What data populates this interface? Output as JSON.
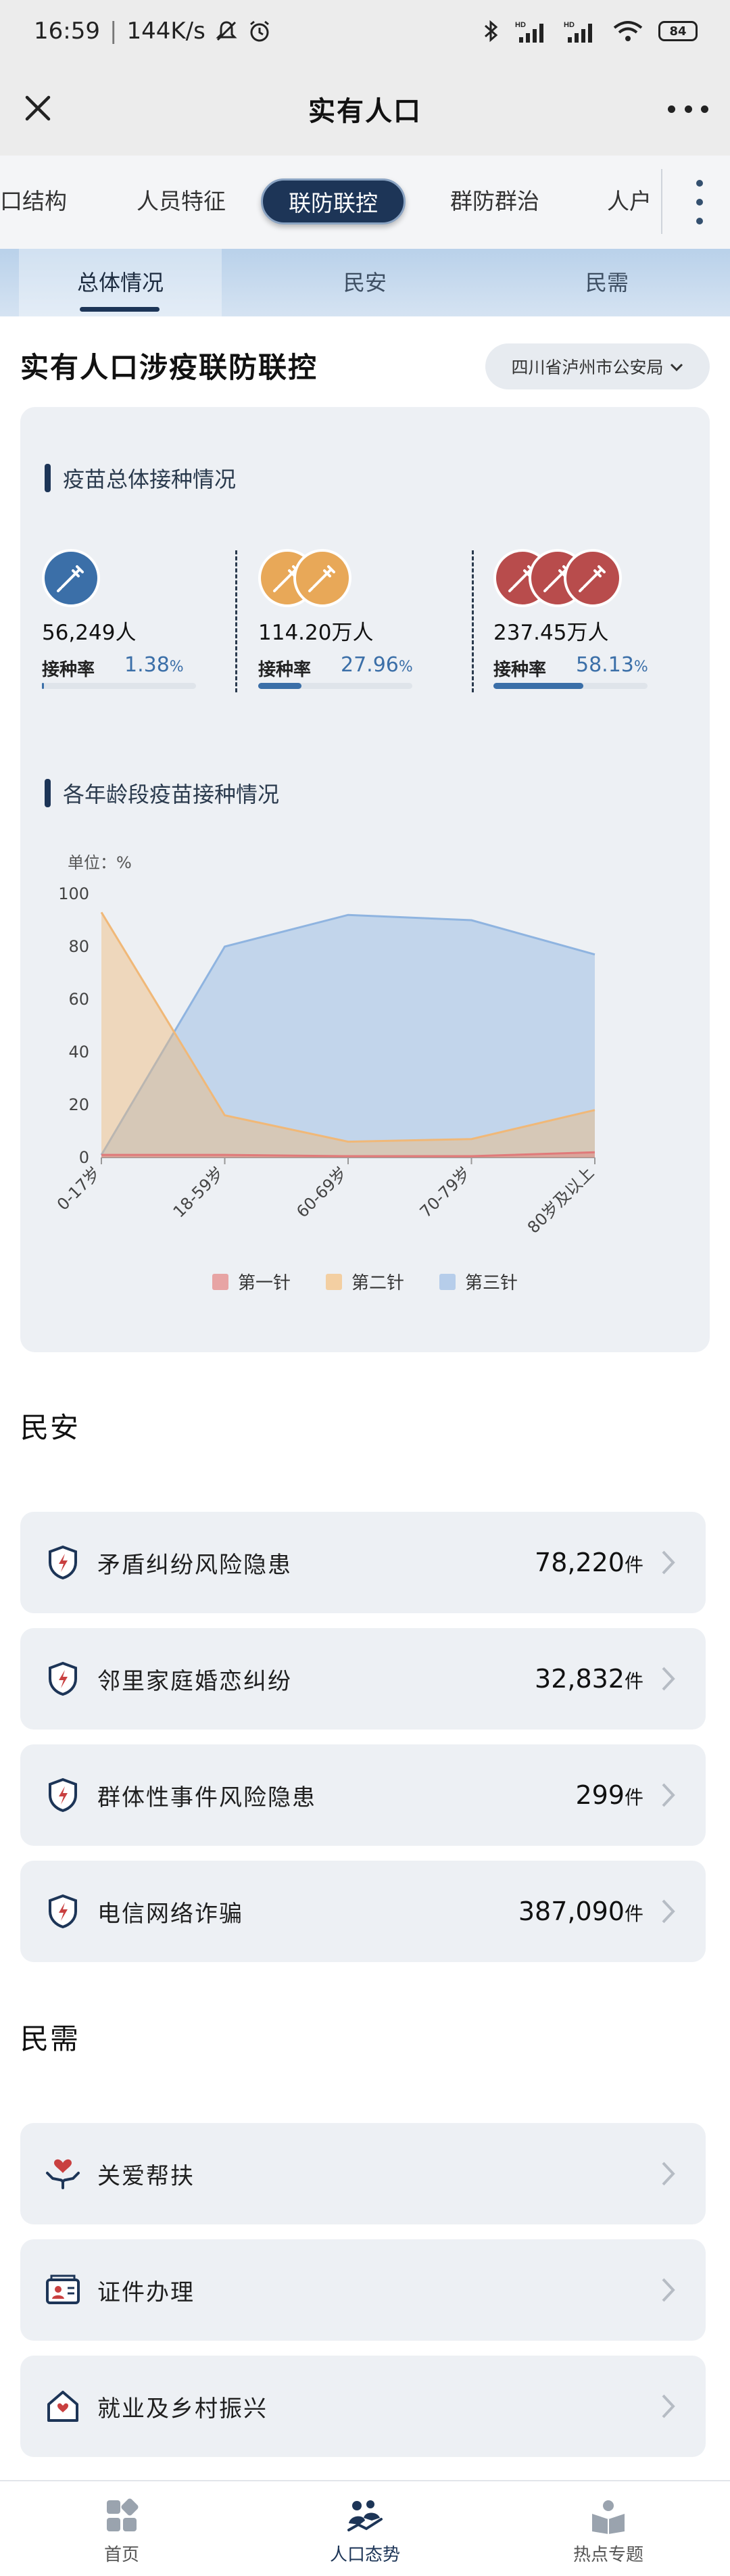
{
  "status_bar": {
    "time": "16:59",
    "speed": "144K/s",
    "battery": "84"
  },
  "header": {
    "title": "实有人口"
  },
  "category_tabs": [
    {
      "label": "口结构"
    },
    {
      "label": "人员特征"
    },
    {
      "label": "联防联控"
    },
    {
      "label": "群防群治"
    },
    {
      "label": "人户"
    }
  ],
  "sub_tabs": [
    {
      "label": "总体情况"
    },
    {
      "label": "民安"
    },
    {
      "label": "民需"
    }
  ],
  "section": {
    "title": "实有人口涉疫联防联控",
    "region": "四川省泸州市公安局"
  },
  "vaccination": {
    "title": "疫苗总体接种情况",
    "rate_label": "接种率",
    "items": [
      {
        "count": "56,249人",
        "rate": "1.38",
        "unit": "%",
        "color": "#3b6fa8",
        "fraction": 0.0138
      },
      {
        "count": "114.20万人",
        "rate": "27.96",
        "unit": "%",
        "color": "#e8a858",
        "fraction": 0.2796
      },
      {
        "count": "237.45万人",
        "rate": "58.13",
        "unit": "%",
        "color": "#b84c4c",
        "fraction": 0.5813
      }
    ]
  },
  "age_chart": {
    "title": "各年龄段疫苗接种情况"
  },
  "chart_data": {
    "type": "area",
    "title": "",
    "unit_label": "单位：%",
    "categories": [
      "0-17岁",
      "18-59岁",
      "60-69岁",
      "70-79岁",
      "80岁及以上"
    ],
    "ylim": [
      0,
      100
    ],
    "yticks": [
      0,
      20,
      40,
      60,
      80,
      100
    ],
    "series": [
      {
        "name": "第一针",
        "values": [
          1,
          1,
          0.5,
          0.5,
          2
        ],
        "color": "#e07a7a"
      },
      {
        "name": "第二针",
        "values": [
          93,
          16,
          6,
          7,
          18
        ],
        "color": "#f0b878"
      },
      {
        "name": "第三针",
        "values": [
          1,
          80,
          92,
          90,
          77
        ],
        "color": "#8fb4e0"
      }
    ],
    "legend": "bottom",
    "grid": false
  },
  "minan": {
    "title": "民安",
    "items": [
      {
        "label": "矛盾纠纷风险隐患",
        "value": "78,220",
        "unit": "件"
      },
      {
        "label": "邻里家庭婚恋纠纷",
        "value": "32,832",
        "unit": "件"
      },
      {
        "label": "群体性事件风险隐患",
        "value": "299",
        "unit": "件"
      },
      {
        "label": "电信网络诈骗",
        "value": "387,090",
        "unit": "件"
      }
    ]
  },
  "minxu": {
    "title": "民需",
    "items": [
      {
        "label": "关爱帮扶",
        "icon": "heart-hands-icon"
      },
      {
        "label": "证件办理",
        "icon": "id-card-icon"
      },
      {
        "label": "就业及乡村振兴",
        "icon": "house-icon"
      }
    ]
  },
  "bottom_nav": [
    {
      "label": "首页"
    },
    {
      "label": "人口态势"
    },
    {
      "label": "热点专题"
    }
  ]
}
